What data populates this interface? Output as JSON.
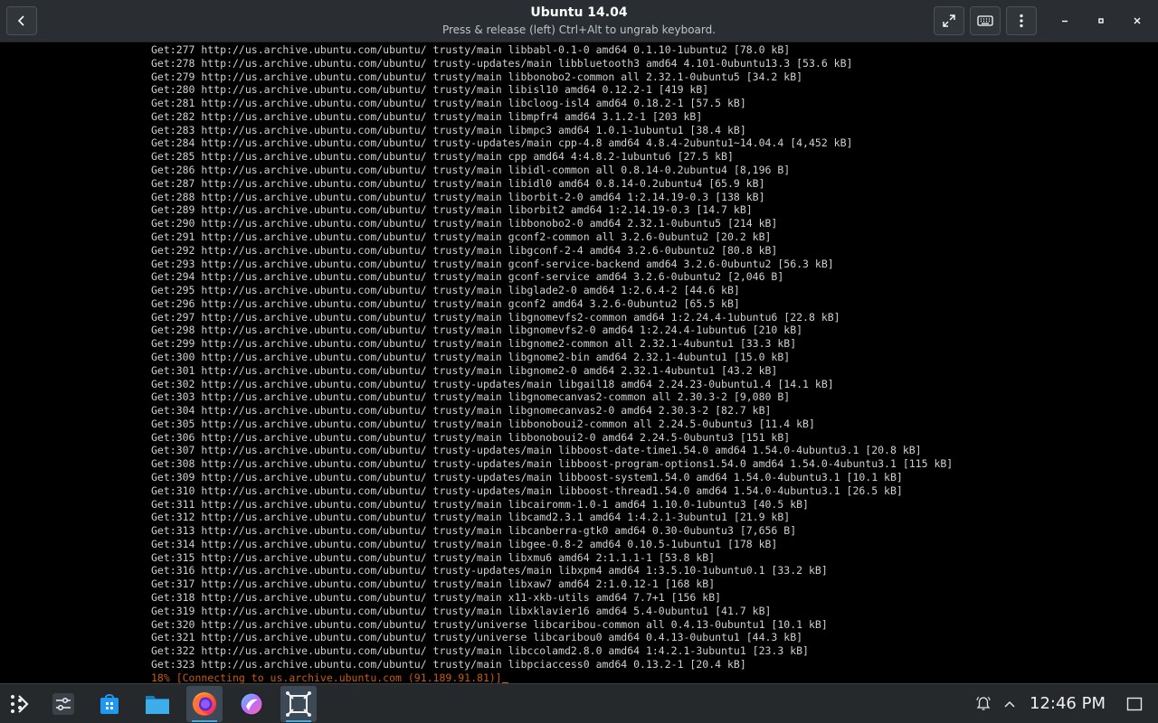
{
  "window": {
    "title": "Ubuntu 14.04",
    "subtitle": "Press & release (left) Ctrl+Alt to ungrab keyboard."
  },
  "terminal": {
    "lines": [
      "Get:277 http://us.archive.ubuntu.com/ubuntu/ trusty/main libbabl-0.1-0 amd64 0.1.10-1ubuntu2 [78.0 kB]",
      "Get:278 http://us.archive.ubuntu.com/ubuntu/ trusty-updates/main libbluetooth3 amd64 4.101-0ubuntu13.3 [53.6 kB]",
      "Get:279 http://us.archive.ubuntu.com/ubuntu/ trusty/main libbonobo2-common all 2.32.1-0ubuntu5 [34.2 kB]",
      "Get:280 http://us.archive.ubuntu.com/ubuntu/ trusty/main libisl10 amd64 0.12.2-1 [419 kB]",
      "Get:281 http://us.archive.ubuntu.com/ubuntu/ trusty/main libcloog-isl4 amd64 0.18.2-1 [57.5 kB]",
      "Get:282 http://us.archive.ubuntu.com/ubuntu/ trusty/main libmpfr4 amd64 3.1.2-1 [203 kB]",
      "Get:283 http://us.archive.ubuntu.com/ubuntu/ trusty/main libmpc3 amd64 1.0.1-1ubuntu1 [38.4 kB]",
      "Get:284 http://us.archive.ubuntu.com/ubuntu/ trusty-updates/main cpp-4.8 amd64 4.8.4-2ubuntu1~14.04.4 [4,452 kB]",
      "Get:285 http://us.archive.ubuntu.com/ubuntu/ trusty/main cpp amd64 4:4.8.2-1ubuntu6 [27.5 kB]",
      "Get:286 http://us.archive.ubuntu.com/ubuntu/ trusty/main libidl-common all 0.8.14-0.2ubuntu4 [8,196 B]",
      "Get:287 http://us.archive.ubuntu.com/ubuntu/ trusty/main libidl0 amd64 0.8.14-0.2ubuntu4 [65.9 kB]",
      "Get:288 http://us.archive.ubuntu.com/ubuntu/ trusty/main liborbit-2-0 amd64 1:2.14.19-0.3 [138 kB]",
      "Get:289 http://us.archive.ubuntu.com/ubuntu/ trusty/main liborbit2 amd64 1:2.14.19-0.3 [14.7 kB]",
      "Get:290 http://us.archive.ubuntu.com/ubuntu/ trusty/main libbonobo2-0 amd64 2.32.1-0ubuntu5 [214 kB]",
      "Get:291 http://us.archive.ubuntu.com/ubuntu/ trusty/main gconf2-common all 3.2.6-0ubuntu2 [20.2 kB]",
      "Get:292 http://us.archive.ubuntu.com/ubuntu/ trusty/main libgconf-2-4 amd64 3.2.6-0ubuntu2 [80.8 kB]",
      "Get:293 http://us.archive.ubuntu.com/ubuntu/ trusty/main gconf-service-backend amd64 3.2.6-0ubuntu2 [56.3 kB]",
      "Get:294 http://us.archive.ubuntu.com/ubuntu/ trusty/main gconf-service amd64 3.2.6-0ubuntu2 [2,046 B]",
      "Get:295 http://us.archive.ubuntu.com/ubuntu/ trusty/main libglade2-0 amd64 1:2.6.4-2 [44.6 kB]",
      "Get:296 http://us.archive.ubuntu.com/ubuntu/ trusty/main gconf2 amd64 3.2.6-0ubuntu2 [65.5 kB]",
      "Get:297 http://us.archive.ubuntu.com/ubuntu/ trusty/main libgnomevfs2-common amd64 1:2.24.4-1ubuntu6 [22.8 kB]",
      "Get:298 http://us.archive.ubuntu.com/ubuntu/ trusty/main libgnomevfs2-0 amd64 1:2.24.4-1ubuntu6 [210 kB]",
      "Get:299 http://us.archive.ubuntu.com/ubuntu/ trusty/main libgnome2-common all 2.32.1-4ubuntu1 [33.3 kB]",
      "Get:300 http://us.archive.ubuntu.com/ubuntu/ trusty/main libgnome2-bin amd64 2.32.1-4ubuntu1 [15.0 kB]",
      "Get:301 http://us.archive.ubuntu.com/ubuntu/ trusty/main libgnome2-0 amd64 2.32.1-4ubuntu1 [43.2 kB]",
      "Get:302 http://us.archive.ubuntu.com/ubuntu/ trusty-updates/main libgail18 amd64 2.24.23-0ubuntu1.4 [14.1 kB]",
      "Get:303 http://us.archive.ubuntu.com/ubuntu/ trusty/main libgnomecanvas2-common all 2.30.3-2 [9,080 B]",
      "Get:304 http://us.archive.ubuntu.com/ubuntu/ trusty/main libgnomecanvas2-0 amd64 2.30.3-2 [82.7 kB]",
      "Get:305 http://us.archive.ubuntu.com/ubuntu/ trusty/main libbonoboui2-common all 2.24.5-0ubuntu3 [11.4 kB]",
      "Get:306 http://us.archive.ubuntu.com/ubuntu/ trusty/main libbonoboui2-0 amd64 2.24.5-0ubuntu3 [151 kB]",
      "Get:307 http://us.archive.ubuntu.com/ubuntu/ trusty-updates/main libboost-date-time1.54.0 amd64 1.54.0-4ubuntu3.1 [20.8 kB]",
      "Get:308 http://us.archive.ubuntu.com/ubuntu/ trusty-updates/main libboost-program-options1.54.0 amd64 1.54.0-4ubuntu3.1 [115 kB]",
      "Get:309 http://us.archive.ubuntu.com/ubuntu/ trusty-updates/main libboost-system1.54.0 amd64 1.54.0-4ubuntu3.1 [10.1 kB]",
      "Get:310 http://us.archive.ubuntu.com/ubuntu/ trusty-updates/main libboost-thread1.54.0 amd64 1.54.0-4ubuntu3.1 [26.5 kB]",
      "Get:311 http://us.archive.ubuntu.com/ubuntu/ trusty/main libcairomm-1.0-1 amd64 1.10.0-1ubuntu3 [40.5 kB]",
      "Get:312 http://us.archive.ubuntu.com/ubuntu/ trusty/main libcamd2.3.1 amd64 1:4.2.1-3ubuntu1 [21.9 kB]",
      "Get:313 http://us.archive.ubuntu.com/ubuntu/ trusty/main libcanberra-gtk0 amd64 0.30-0ubuntu3 [7,656 B]",
      "Get:314 http://us.archive.ubuntu.com/ubuntu/ trusty/main libgee-0.8-2 amd64 0.10.5-1ubuntu1 [178 kB]",
      "Get:315 http://us.archive.ubuntu.com/ubuntu/ trusty/main libxmu6 amd64 2:1.1.1-1 [53.8 kB]",
      "Get:316 http://us.archive.ubuntu.com/ubuntu/ trusty-updates/main libxpm4 amd64 1:3.5.10-1ubuntu0.1 [33.2 kB]",
      "Get:317 http://us.archive.ubuntu.com/ubuntu/ trusty/main libxaw7 amd64 2:1.0.12-1 [168 kB]",
      "Get:318 http://us.archive.ubuntu.com/ubuntu/ trusty/main x11-xkb-utils amd64 7.7+1 [156 kB]",
      "Get:319 http://us.archive.ubuntu.com/ubuntu/ trusty/main libxklavier16 amd64 5.4-0ubuntu1 [41.7 kB]",
      "Get:320 http://us.archive.ubuntu.com/ubuntu/ trusty/universe libcaribou-common all 0.4.13-0ubuntu1 [10.1 kB]",
      "Get:321 http://us.archive.ubuntu.com/ubuntu/ trusty/universe libcaribou0 amd64 0.4.13-0ubuntu1 [44.3 kB]",
      "Get:322 http://us.archive.ubuntu.com/ubuntu/ trusty/main libccolamd2.8.0 amd64 1:4.2.1-3ubuntu1 [23.3 kB]",
      "Get:323 http://us.archive.ubuntu.com/ubuntu/ trusty/main libpciaccess0 amd64 0.13.2-1 [20.4 kB]"
    ],
    "status_line": "18% [Connecting to us.archive.ubuntu.com (91.189.91.81)]"
  },
  "taskbar": {
    "clock": "12:46 PM",
    "apps": [
      "launcher-icon",
      "settings-icon",
      "discover-icon",
      "files-icon",
      "firefox-icon",
      "kde-app-icon",
      "steam-link-icon"
    ]
  },
  "colors": {
    "titlebar": "#2a2e32",
    "terminal_bg": "#000000",
    "terminal_fg": "#d0d0d0",
    "status_fg": "#c45c10",
    "taskbar": "#25292c",
    "accent": "#3daee9"
  }
}
